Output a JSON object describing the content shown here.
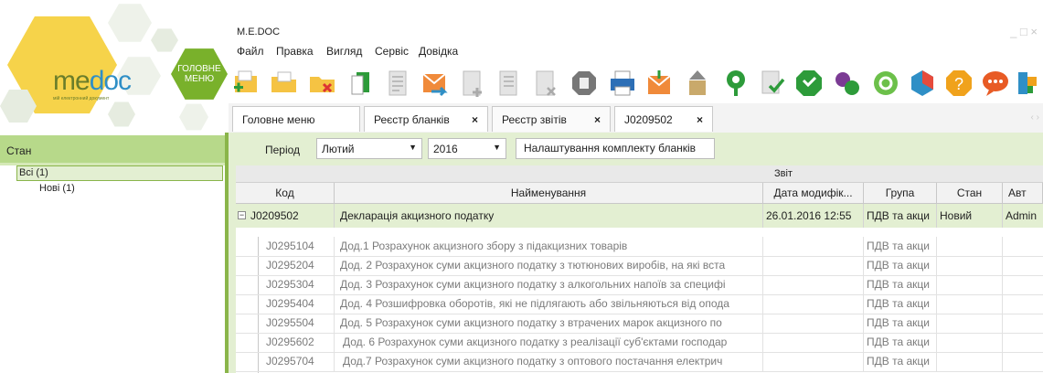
{
  "logo": {
    "me": "me",
    "doc": "doc",
    "tagline": "мій електронний документ"
  },
  "menu_tile": {
    "line1": "ГОЛОВНЕ",
    "line2": "МЕНЮ"
  },
  "window": {
    "title": "M.E.DOC",
    "controls": "_ □ ×"
  },
  "menu": [
    "Файл",
    "Правка",
    "Вигляд",
    "Сервіс",
    "Довідка"
  ],
  "tabs": [
    {
      "label": "Головне меню",
      "closable": false
    },
    {
      "label": "Реєстр бланків",
      "closable": true
    },
    {
      "label": "Реєстр звітів",
      "closable": true,
      "active": true
    },
    {
      "label": "J0209502",
      "closable": true
    }
  ],
  "tab_close": "×",
  "tab_scroll": "‹ ›",
  "left_panel": {
    "header": "Стан",
    "tree": [
      {
        "label": "Всі (1)",
        "selected": true
      },
      {
        "label": "Нові (1)"
      }
    ]
  },
  "filter": {
    "period_label": "Період",
    "month": "Лютий",
    "year": "2016",
    "settings_button": "Налаштування комплекту бланків"
  },
  "grid": {
    "group_header": "Звіт",
    "columns": [
      "Код",
      "Найменування",
      "Дата модифік...",
      "Група",
      "Стан",
      "Авт"
    ],
    "main_row": {
      "expand": "−",
      "code": "J0209502",
      "name": "Декларація акцизного податку",
      "date": "26.01.2016 12:55",
      "group": "ПДВ та акци",
      "status": "Новий",
      "author": "Admin"
    },
    "sub_rows": [
      {
        "code": "J0295104",
        "name": "Дод.1 Розрахунок акцизного збору з підакцизних товарів",
        "group": "ПДВ та акци"
      },
      {
        "code": "J0295204",
        "name": "Дод. 2 Розрахунок суми акцизного податку з тютюнових виробів, на які вста",
        "group": "ПДВ та акци"
      },
      {
        "code": "J0295304",
        "name": "Дод. 3 Розрахунок суми акцизного податку з алкогольних напоїв за специфі",
        "group": "ПДВ та акци"
      },
      {
        "code": "J0295404",
        "name": "Дод. 4 Розшифровка оборотів, які не підлягають або звільняються від опода",
        "group": "ПДВ та акци"
      },
      {
        "code": "J0295504",
        "name": "Дод. 5 Розрахунок суми акцизного податку з втрачених марок акцизного по",
        "group": "ПДВ та акци"
      },
      {
        "code": "J0295602",
        "name": "Дод. 6 Розрахунок суми акцизного податку з реалізації суб'єктами господар",
        "group": "ПДВ та акци"
      },
      {
        "code": "J0295704",
        "name": "Дод.7 Розрахунок суми акцизного податку з оптового постачання електрич",
        "group": "ПДВ та акци"
      }
    ]
  },
  "colors": {
    "panel_green": "#e3efd2",
    "accent_green": "#8ab54a",
    "logo_yellow": "#f6d34a",
    "menu_green": "#79b12b"
  },
  "toolbar_icons": [
    "new-report-icon",
    "open-folder-icon",
    "delete-folder-icon",
    "copy-document-icon",
    "document-list-icon",
    "send-envelope-icon",
    "add-document-icon",
    "edit-document-icon",
    "remove-document-icon",
    "archive-icon",
    "print-icon",
    "receive-envelope-icon",
    "upload-icon",
    "sign-key-icon",
    "check-document-icon",
    "shield-icon",
    "group-icon",
    "refresh-icon",
    "settings-puzzle-icon",
    "help-icon",
    "chat-icon",
    "network-icon"
  ]
}
